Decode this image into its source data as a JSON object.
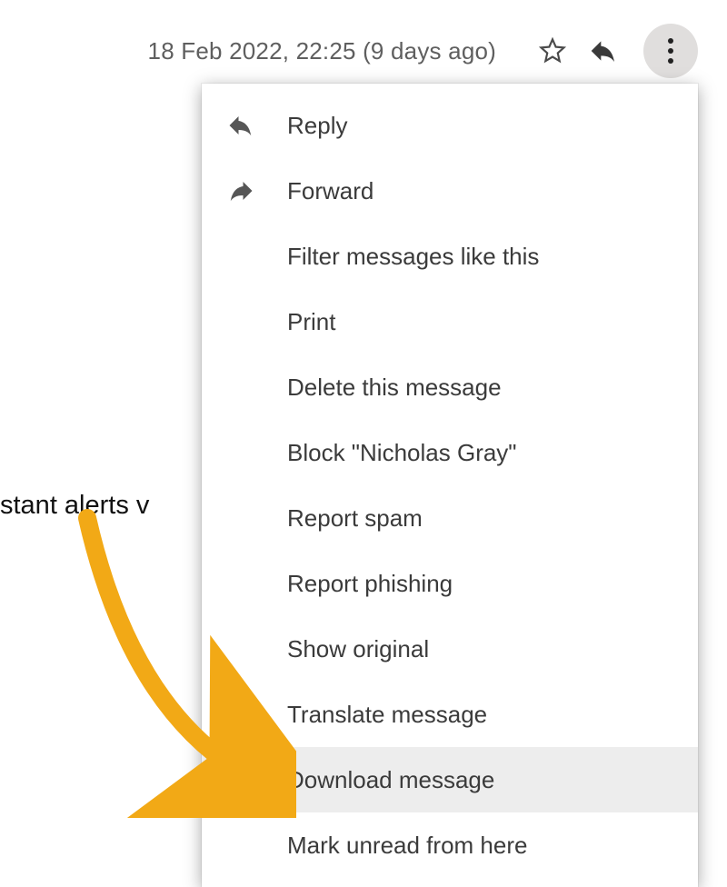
{
  "header": {
    "timestamp": "18 Feb 2022, 22:25 (9 days ago)"
  },
  "background": {
    "partial_text": "stant alerts v"
  },
  "menu": {
    "items": [
      {
        "label": "Reply",
        "icon": "reply",
        "highlighted": false
      },
      {
        "label": "Forward",
        "icon": "forward",
        "highlighted": false
      },
      {
        "label": "Filter messages like this",
        "icon": null,
        "highlighted": false
      },
      {
        "label": "Print",
        "icon": null,
        "highlighted": false
      },
      {
        "label": "Delete this message",
        "icon": null,
        "highlighted": false
      },
      {
        "label": "Block \"Nicholas Gray\"",
        "icon": null,
        "highlighted": false
      },
      {
        "label": "Report spam",
        "icon": null,
        "highlighted": false
      },
      {
        "label": "Report phishing",
        "icon": null,
        "highlighted": false
      },
      {
        "label": "Show original",
        "icon": null,
        "highlighted": false
      },
      {
        "label": "Translate message",
        "icon": null,
        "highlighted": false
      },
      {
        "label": "Download message",
        "icon": null,
        "highlighted": true
      },
      {
        "label": "Mark unread from here",
        "icon": null,
        "highlighted": false
      }
    ],
    "highlighted_index": 10
  },
  "colors": {
    "arrow": "#f2a916",
    "timestamp": "#5f5f5f",
    "menu_text": "#3b3b3b",
    "more_bg": "#e0dedd"
  }
}
